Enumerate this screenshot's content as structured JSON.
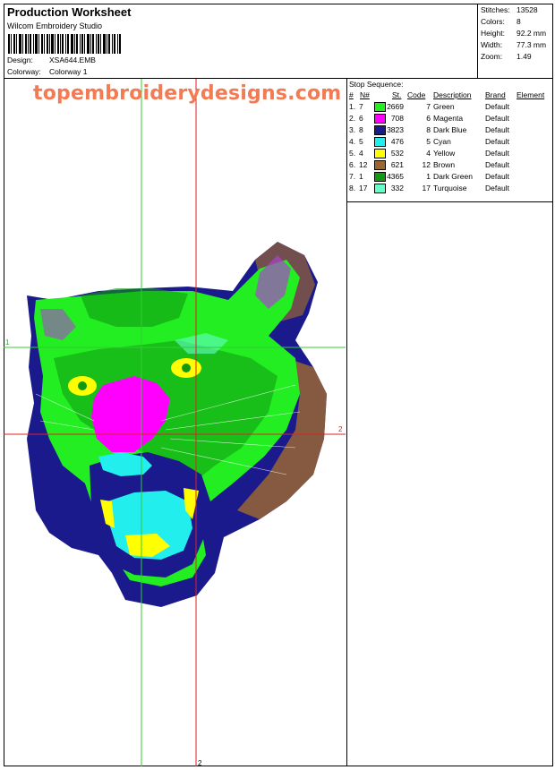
{
  "header": {
    "title": "Production Worksheet",
    "software": "Wilcom  Embroidery Studio",
    "design_label": "Design:",
    "design_value": "XSA644.EMB",
    "colorway_label": "Colorway:",
    "colorway_value": "Colorway 1"
  },
  "stats": {
    "stitches_label": "Stitches:",
    "stitches_value": "13528",
    "colors_label": "Colors:",
    "colors_value": "8",
    "height_label": "Height:",
    "height_value": "92.2 mm",
    "width_label": "Width:",
    "width_value": "77.3 mm",
    "zoom_label": "Zoom:",
    "zoom_value": "1.49"
  },
  "watermark": "topembroiderydesigns.com",
  "guides": {
    "h1_label": "1",
    "h2_label": "2",
    "v2_label": "2"
  },
  "sequence": {
    "title": "Stop Sequence:",
    "headers": {
      "num": "#",
      "n": "N#",
      "st": "St.",
      "code": "Code",
      "description": "Description",
      "brand": "Brand",
      "element": "Element"
    },
    "rows": [
      {
        "num": "1.",
        "n": "7",
        "color": "#22ee22",
        "st": "2669",
        "code": "7",
        "description": "Green",
        "brand": "Default"
      },
      {
        "num": "2.",
        "n": "6",
        "color": "#ff00ff",
        "st": "708",
        "code": "6",
        "description": "Magenta",
        "brand": "Default"
      },
      {
        "num": "3.",
        "n": "8",
        "color": "#1a1a8c",
        "st": "3823",
        "code": "8",
        "description": "Dark Blue",
        "brand": "Default"
      },
      {
        "num": "4.",
        "n": "5",
        "color": "#22eeee",
        "st": "476",
        "code": "5",
        "description": "Cyan",
        "brand": "Default"
      },
      {
        "num": "5.",
        "n": "4",
        "color": "#ffff00",
        "st": "532",
        "code": "4",
        "description": "Yellow",
        "brand": "Default"
      },
      {
        "num": "6.",
        "n": "12",
        "color": "#996633",
        "st": "621",
        "code": "12",
        "description": "Brown",
        "brand": "Default"
      },
      {
        "num": "7.",
        "n": "1",
        "color": "#119911",
        "st": "4365",
        "code": "1",
        "description": "Dark Green",
        "brand": "Default"
      },
      {
        "num": "8.",
        "n": "17",
        "color": "#66ffcc",
        "st": "332",
        "code": "17",
        "description": "Turquoise",
        "brand": "Default"
      }
    ]
  }
}
